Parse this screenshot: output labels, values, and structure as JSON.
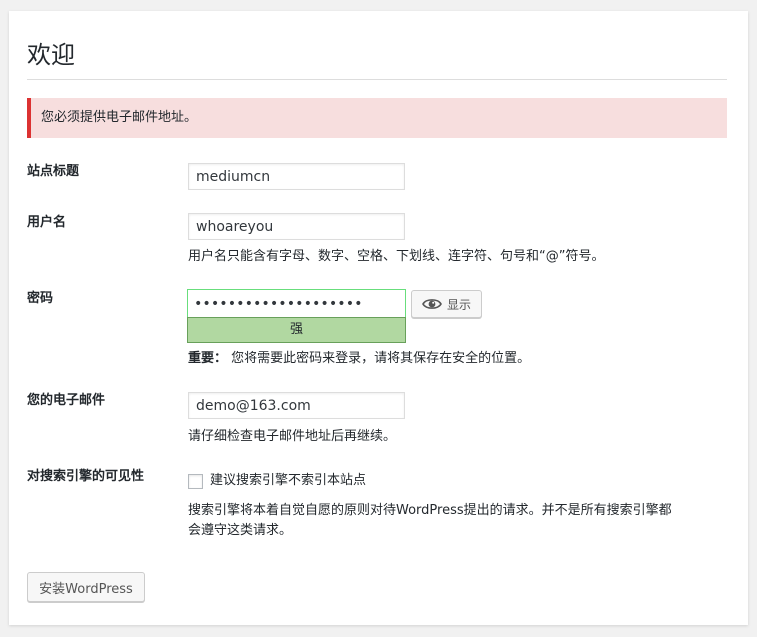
{
  "page": {
    "title": "欢迎",
    "error_notice": "您必须提供电子邮件地址。"
  },
  "form": {
    "site_title": {
      "label": "站点标题",
      "value": "mediumcn"
    },
    "username": {
      "label": "用户名",
      "value": "whoareyou",
      "description": "用户名只能含有字母、数字、空格、下划线、连字符、句号和“@”符号。"
    },
    "password": {
      "label": "密码",
      "masked_value": "••••••••••••••••••••",
      "show_button_label": "显示",
      "strength": "强",
      "important_label": "重要：",
      "important_text": "您将需要此密码来登录，请将其保存在安全的位置。"
    },
    "email": {
      "label": "您的电子邮件",
      "value": "demo@163.com",
      "description": "请仔细检查电子邮件地址后再继续。"
    },
    "visibility": {
      "label": "对搜索引擎的可见性",
      "checkbox_label": "建议搜索引擎不索引本站点",
      "checked": false,
      "description_line1": "搜索引擎将本着自觉自愿的原则对待WordPress提出的请求。并不是所有搜索引擎都",
      "description_line2": "会遵守这类请求。"
    },
    "submit_label": "安装WordPress"
  },
  "colors": {
    "notice_bg": "#f7dede",
    "notice_border": "#dc3232",
    "strength_bg": "#b1d8a1",
    "strength_border": "#68de7c"
  },
  "icons": {
    "show_password": "eye-icon"
  }
}
